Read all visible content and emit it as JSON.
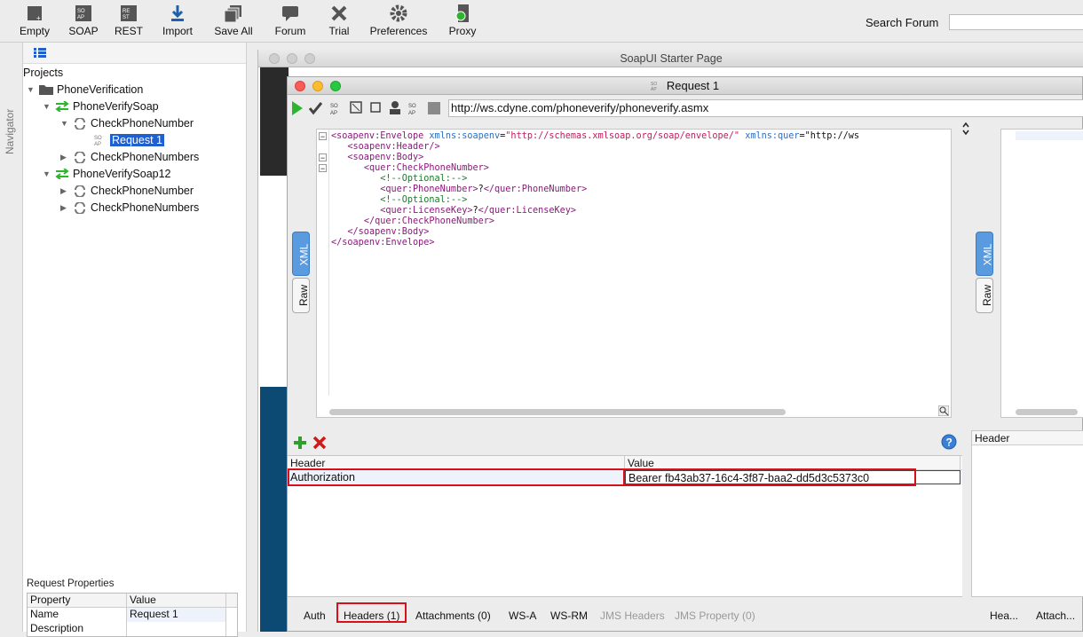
{
  "toolbar": {
    "buttons": [
      {
        "label": "Empty",
        "icon": "empty-project-icon"
      },
      {
        "label": "SOAP",
        "icon": "soap-icon"
      },
      {
        "label": "REST",
        "icon": "rest-icon"
      },
      {
        "label": "Import",
        "icon": "import-icon"
      },
      {
        "label": "Save All",
        "icon": "save-all-icon"
      },
      {
        "label": "Forum",
        "icon": "forum-icon"
      },
      {
        "label": "Trial",
        "icon": "trial-icon"
      },
      {
        "label": "Preferences",
        "icon": "gear-icon"
      },
      {
        "label": "Proxy",
        "icon": "proxy-icon"
      }
    ],
    "search_label": "Search Forum",
    "search_value": ""
  },
  "navigator": {
    "strip_label": "Navigator",
    "root_label": "Projects",
    "tree": [
      {
        "label": "PhoneVerification",
        "level": 0,
        "type": "project"
      },
      {
        "label": "PhoneVerifySoap",
        "level": 1,
        "type": "interface"
      },
      {
        "label": "CheckPhoneNumber",
        "level": 2,
        "type": "operation"
      },
      {
        "label": "Request 1",
        "level": 3,
        "type": "request",
        "selected": true
      },
      {
        "label": "CheckPhoneNumbers",
        "level": 2,
        "type": "operation"
      },
      {
        "label": "PhoneVerifySoap12",
        "level": 1,
        "type": "interface"
      },
      {
        "label": "CheckPhoneNumber",
        "level": 2,
        "type": "operation"
      },
      {
        "label": "CheckPhoneNumbers",
        "level": 2,
        "type": "operation"
      }
    ]
  },
  "request_properties": {
    "title": "Request Properties",
    "columns": [
      "Property",
      "Value"
    ],
    "rows": [
      {
        "property": "Name",
        "value": "Request 1"
      },
      {
        "property": "Description",
        "value": ""
      }
    ]
  },
  "starter_page": {
    "title": "SoapUI Starter Page"
  },
  "request_window": {
    "title": "Request 1",
    "endpoint": "http://ws.cdyne.com/phoneverify/phoneverify.asmx",
    "xml_lines": [
      "<soapenv:Envelope xmlns:soapenv=\"http://schemas.xmlsoap.org/soap/envelope/\" xmlns:quer=\"http://ws",
      "   <soapenv:Header/>",
      "   <soapenv:Body>",
      "      <quer:CheckPhoneNumber>",
      "         <!--Optional:-->",
      "         <quer:PhoneNumber>?</quer:PhoneNumber>",
      "         <!--Optional:-->",
      "         <quer:LicenseKey>?</quer:LicenseKey>",
      "      </quer:CheckPhoneNumber>",
      "   </soapenv:Body>",
      "</soapenv:Envelope>"
    ],
    "side_tabs": {
      "xml": "XML",
      "raw": "Raw"
    },
    "headers_table": {
      "columns": [
        "Header",
        "Value"
      ],
      "rows": [
        {
          "header": "Authorization",
          "value": "Bearer fb43ab37-16c4-3f87-baa2-dd5d3c5373c0"
        }
      ]
    },
    "right_table_header": "Header",
    "bottom_tabs": [
      {
        "label": "Auth",
        "enabled": true
      },
      {
        "label": "Headers (1)",
        "enabled": true,
        "active": true
      },
      {
        "label": "Attachments (0)",
        "enabled": true
      },
      {
        "label": "WS-A",
        "enabled": true
      },
      {
        "label": "WS-RM",
        "enabled": true
      },
      {
        "label": "JMS Headers",
        "enabled": false
      },
      {
        "label": "JMS Property (0)",
        "enabled": false
      }
    ],
    "right_bottom_tabs": [
      "Hea...",
      "Attach..."
    ]
  },
  "colors": {
    "selection": "#1f5fd0",
    "highlight_box": "#d8101a",
    "play": "#2db52d",
    "add": "#2e9e2e",
    "remove": "#d01818"
  }
}
